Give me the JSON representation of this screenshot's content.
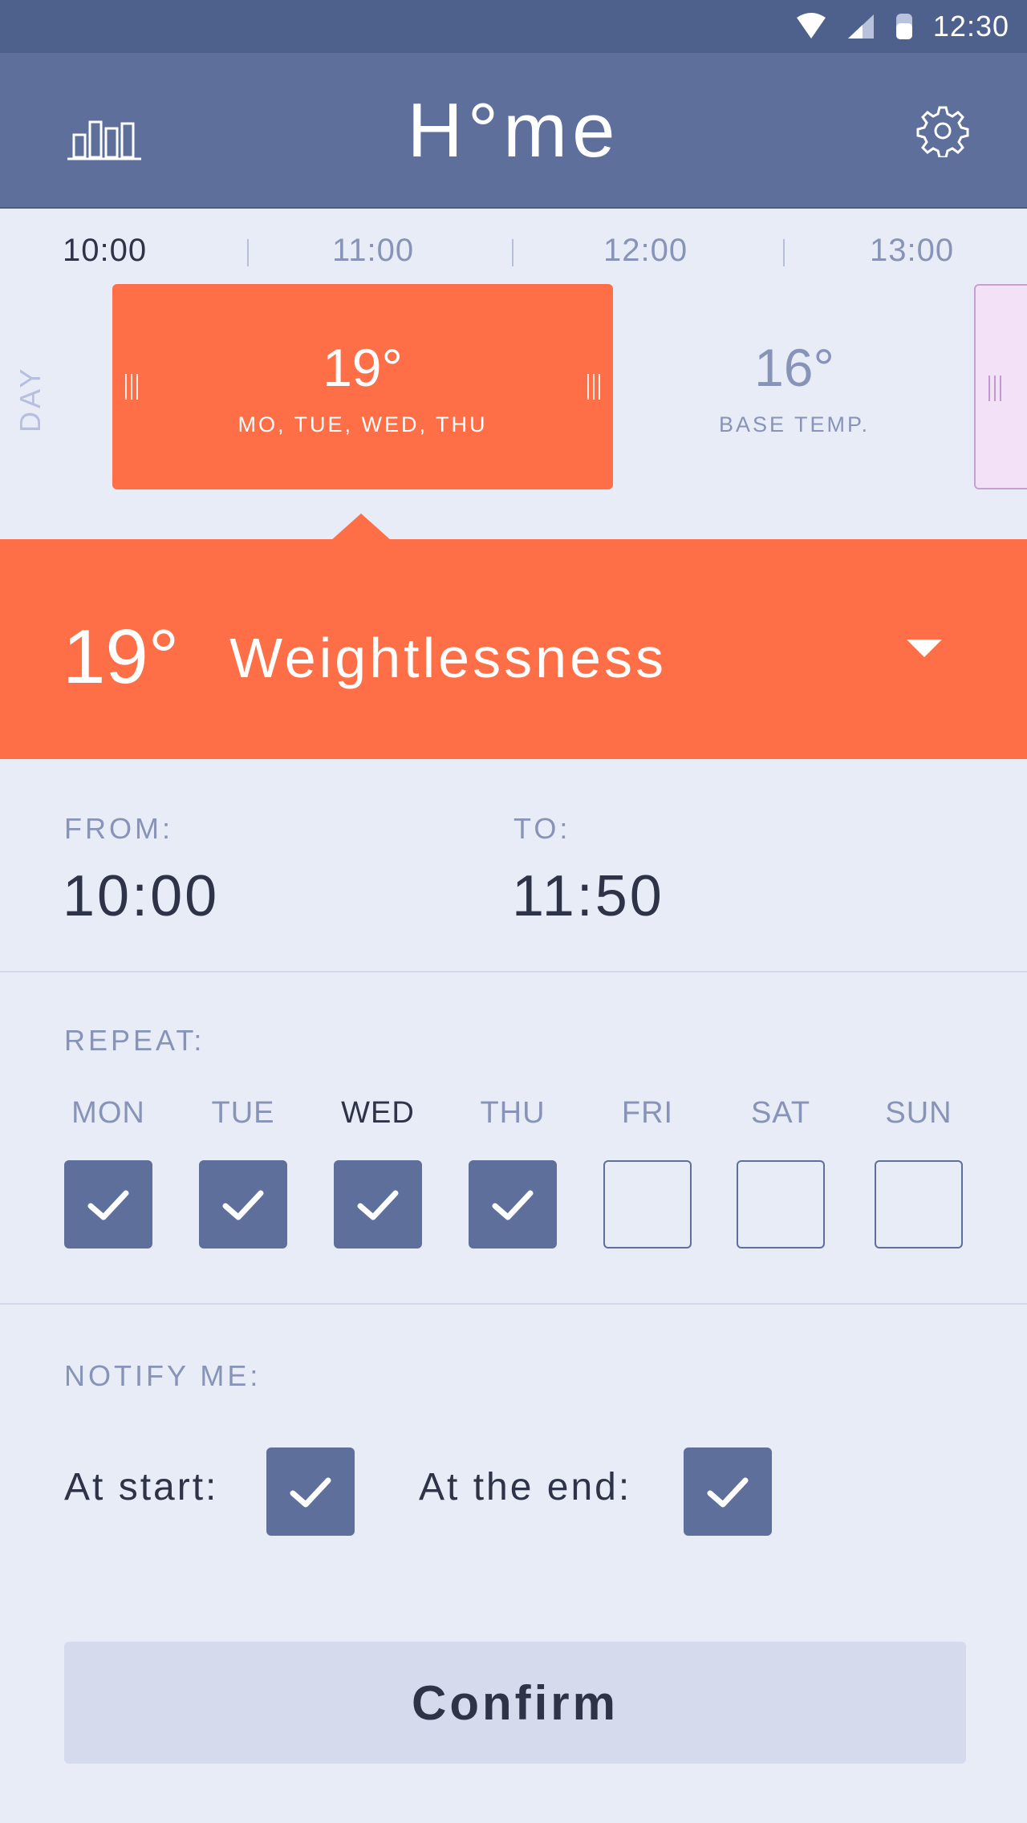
{
  "status_bar": {
    "time": "12:30",
    "icons": [
      "wifi-icon",
      "signal-icon",
      "battery-icon"
    ]
  },
  "app_bar": {
    "title": "H°me",
    "left_icon": "bar-chart-icon",
    "right_icon": "gear-icon"
  },
  "timeline": {
    "ticks": [
      "10:00",
      "11:00",
      "12:00",
      "13:00"
    ],
    "active_tick": "10:00",
    "row_label": "DAY",
    "active_block": {
      "temp": "19°",
      "days": "MO, TUE, WED, THU"
    },
    "base_block": {
      "temp": "16°",
      "label": "BASE TEMP."
    }
  },
  "selected": {
    "temp": "19°",
    "name": "Weightlessness"
  },
  "schedule": {
    "from_label": "FROM:",
    "from_value": "10:00",
    "to_label": "TO:",
    "to_value": "11:50"
  },
  "repeat": {
    "label": "REPEAT:",
    "days": [
      {
        "name": "MON",
        "checked": true
      },
      {
        "name": "TUE",
        "checked": true
      },
      {
        "name": "WED",
        "checked": true,
        "today": true
      },
      {
        "name": "THU",
        "checked": true
      },
      {
        "name": "FRI",
        "checked": false
      },
      {
        "name": "SAT",
        "checked": false
      },
      {
        "name": "SUN",
        "checked": false
      }
    ]
  },
  "notify": {
    "label": "NOTIFY ME:",
    "at_start_label": "At start:",
    "at_start_checked": true,
    "at_end_label": "At the end:",
    "at_end_checked": true
  },
  "confirm_label": "Confirm",
  "colors": {
    "accent": "#ff6f47",
    "primary": "#5e6f9b",
    "status_bar": "#4e608c",
    "background": "#e8ecf7"
  }
}
